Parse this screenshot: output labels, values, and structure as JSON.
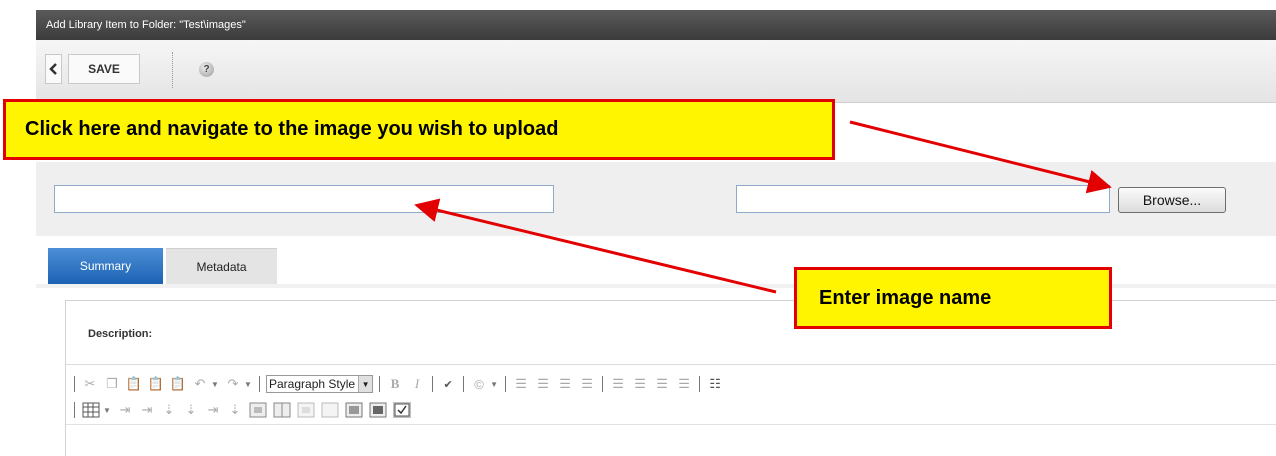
{
  "window": {
    "title": "Add Library Item to Folder: \"Test\\images\""
  },
  "toolbar": {
    "back_icon": "chevron-left-icon",
    "save_label": "SAVE",
    "help_icon": "help-icon",
    "help_glyph": "?"
  },
  "form": {
    "name_value": "",
    "file_value": "",
    "browse_label": "Browse..."
  },
  "tabs": [
    {
      "label": "Summary",
      "active": true
    },
    {
      "label": "Metadata",
      "active": false
    }
  ],
  "editor": {
    "description_label": "Description:",
    "paragraph_style": "Paragraph Style",
    "bold_glyph": "B",
    "italic_glyph": "I"
  },
  "annotations": {
    "upload_hint": "Click here and navigate to the image you wish to upload",
    "name_hint": "Enter image name",
    "highlight_color": "#fff500",
    "border_color": "#e30000"
  }
}
